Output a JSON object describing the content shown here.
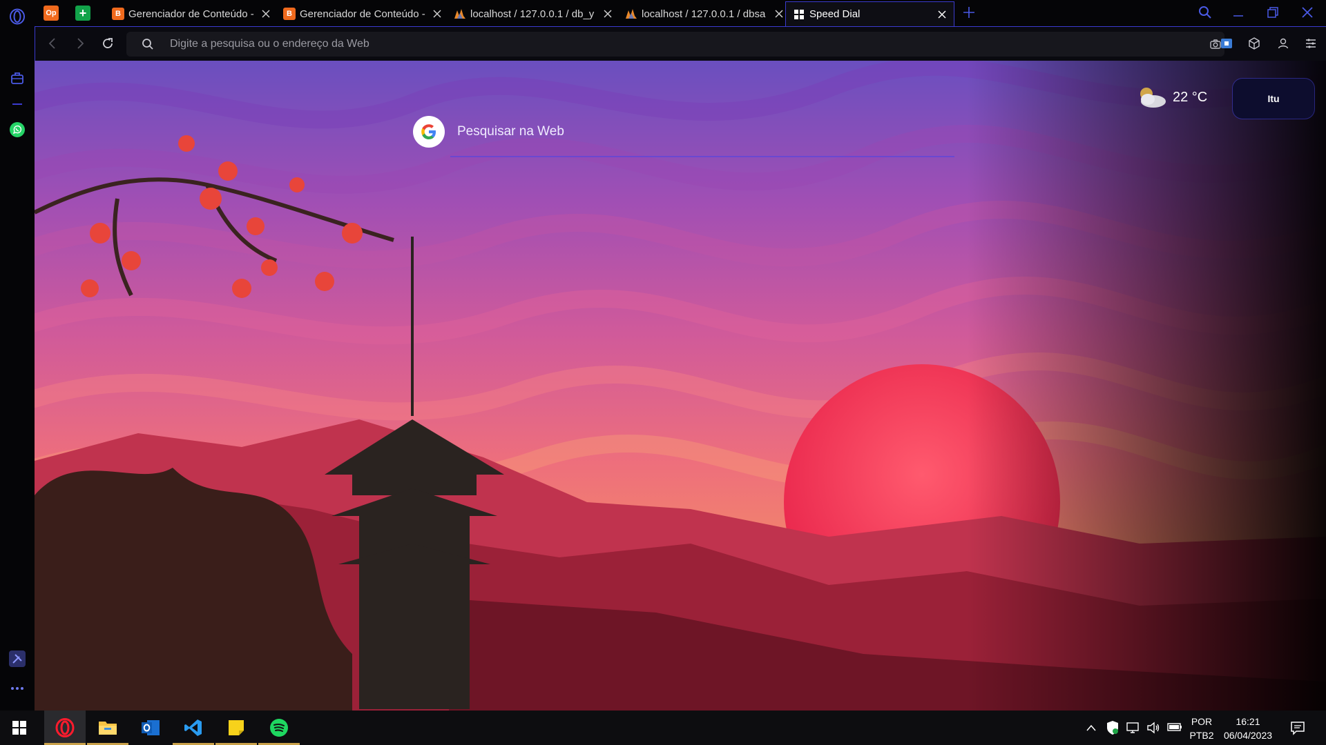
{
  "browser": {
    "tabs": [
      {
        "title": "Gerenciador de Conteúdo -",
        "icon": "ob-icon",
        "active": false
      },
      {
        "title": "Gerenciador de Conteúdo -",
        "icon": "ob-icon",
        "active": false
      },
      {
        "title": "localhost / 127.0.0.1 / db_y",
        "icon": "phpmyadmin-icon",
        "active": false
      },
      {
        "title": "localhost / 127.0.0.1 / dbsa",
        "icon": "phpmyadmin-icon",
        "active": false
      },
      {
        "title": "Speed Dial",
        "icon": "speed-dial-icon",
        "active": true
      }
    ],
    "pinned": [
      {
        "label": "Op",
        "color": "#f06a1d"
      },
      {
        "label": "+",
        "color": "#12a34a"
      }
    ],
    "address_bar": {
      "placeholder": "Digite a pesquisa ou o endereço da Web",
      "value": ""
    },
    "accent_color": "#3b3bd0"
  },
  "speed_dial": {
    "search_placeholder": "Pesquisar na Web",
    "google_letter": "G",
    "weather": {
      "temperature": "22 °C",
      "city": "Itu",
      "icon": "partly-cloudy-icon"
    }
  },
  "taskbar": {
    "apps": [
      {
        "name": "opera-icon",
        "active": true
      },
      {
        "name": "file-explorer-icon",
        "active": false
      },
      {
        "name": "outlook-icon",
        "active": false
      },
      {
        "name": "vscode-icon",
        "active": false
      },
      {
        "name": "sticky-notes-icon",
        "active": false
      },
      {
        "name": "spotify-icon",
        "active": false
      }
    ],
    "language": "POR",
    "keyboard": "PTB2",
    "time": "16:21",
    "date": "06/04/2023"
  }
}
